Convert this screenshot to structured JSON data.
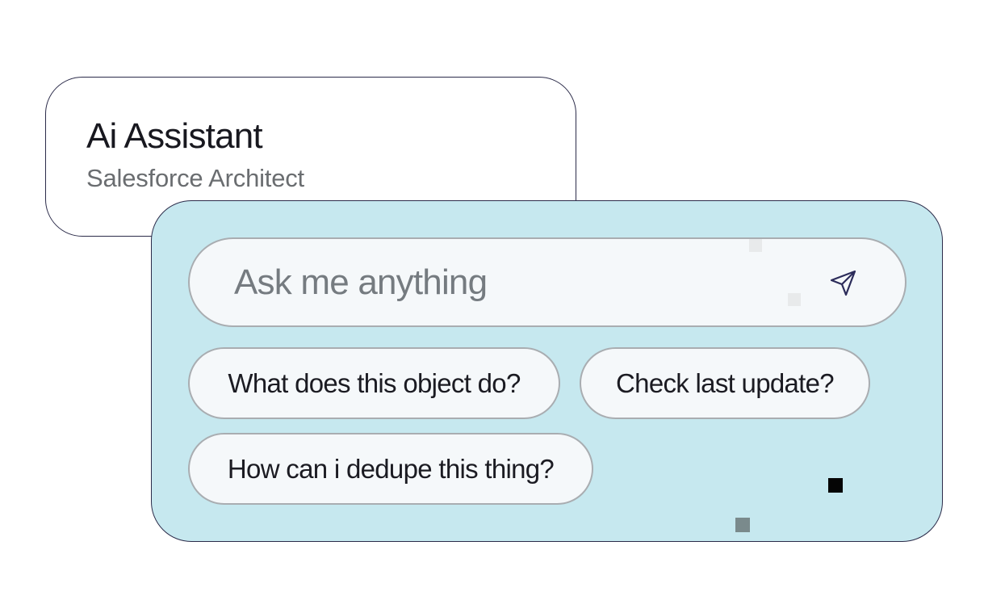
{
  "header": {
    "title": "Ai Assistant",
    "subtitle": "Salesforce Architect"
  },
  "chat": {
    "input": {
      "placeholder": "Ask me anything",
      "send_icon": "send-icon"
    },
    "suggestions": [
      "What does this object do?",
      "Check last update?",
      "How can i dedupe this thing?"
    ]
  },
  "colors": {
    "panel_background": "#c6e8ef",
    "border": "#2c2c4a",
    "chip_background": "#f5f8fa",
    "chip_border": "#a9adb1",
    "placeholder_text": "#757b80",
    "subtitle_text": "#6a6d70",
    "send_icon_stroke": "#2c2c5a"
  }
}
